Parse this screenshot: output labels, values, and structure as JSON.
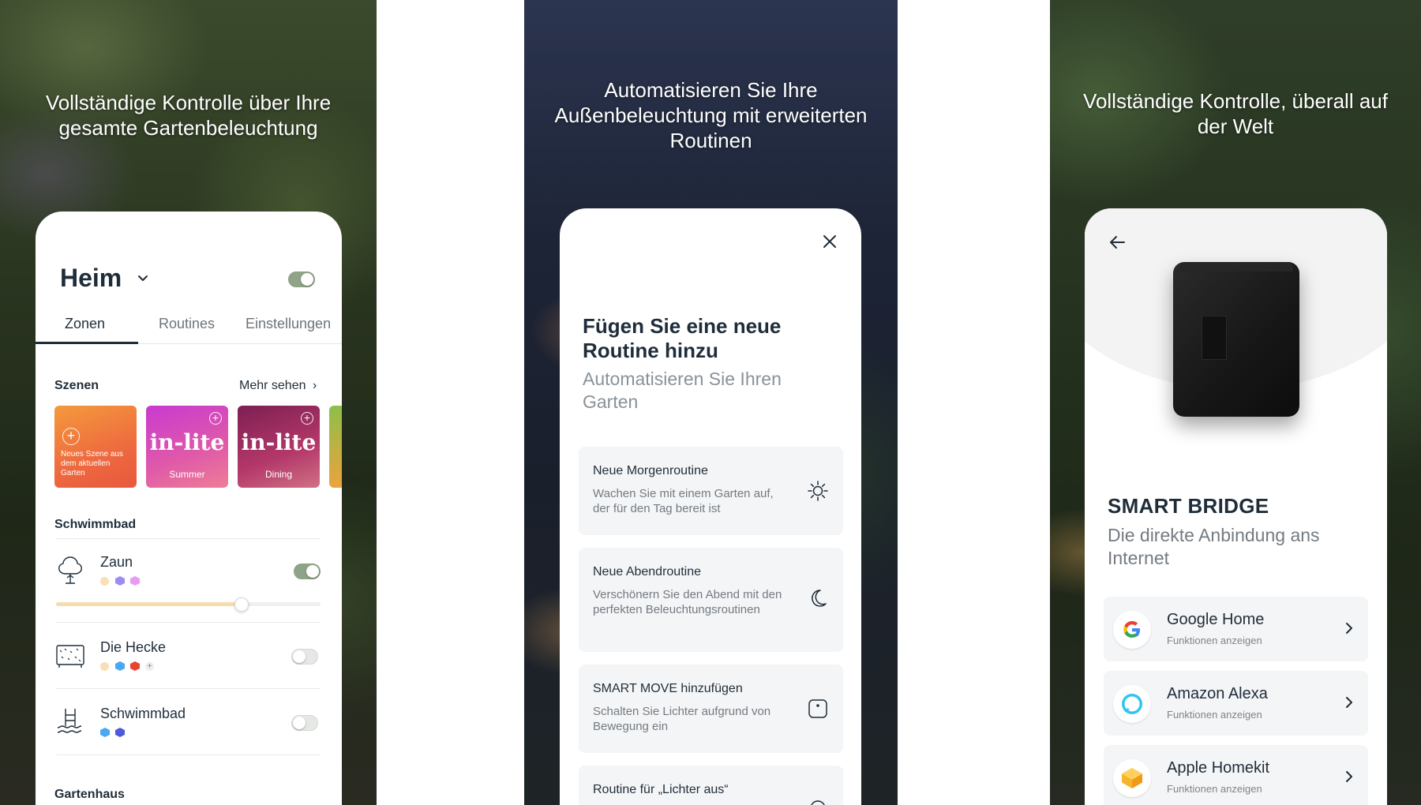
{
  "panel1": {
    "headline": "Vollständige Kontrolle über Ihre gesamte Gartenbeleuchtung",
    "home_title": "Heim",
    "tabs": [
      "Zonen",
      "Routines",
      "Einstellungen"
    ],
    "scenes_label": "Szenen",
    "more_link": "Mehr sehen",
    "scenes": [
      {
        "text": "Neues Szene aus dem aktuellen Garten"
      },
      {
        "brand": "in-lite",
        "label": "Summer"
      },
      {
        "brand": "in-lite",
        "label": "Dining"
      }
    ],
    "group1": "Schwimmbad",
    "zones": [
      {
        "name": "Zaun",
        "on": true,
        "brightness": 0.7
      },
      {
        "name": "Die Hecke",
        "on": false
      },
      {
        "name": "Schwimmbad",
        "on": false
      }
    ],
    "group2": "Gartenhaus",
    "colors": {
      "toggle_on": "#8fa387",
      "accent_text": "#1f2d3a"
    }
  },
  "panel2": {
    "headline": "Automatisieren Sie Ihre Außenbeleuchtung mit erweiterten Routinen",
    "title": "Fügen Sie eine neue Routine hinzu",
    "subtitle": "Automatisieren Sie Ihren Garten",
    "cards": [
      {
        "title": "Neue Morgenroutine",
        "desc": "Wachen Sie mit einem Garten auf, der für den Tag bereit ist",
        "icon": "sun-icon"
      },
      {
        "title": "Neue Abendroutine",
        "desc": "Verschönern Sie den Abend mit den perfekten Beleuchtungsroutinen",
        "icon": "moon-icon"
      },
      {
        "title": "SMART MOVE hinzufügen",
        "desc": "Schalten Sie Lichter aufgrund von Bewegung ein",
        "icon": "motion-sensor-icon"
      },
      {
        "title": "Routine für „Lichter aus“",
        "desc": "",
        "icon": "power-icon"
      }
    ]
  },
  "panel3": {
    "headline": "Vollständige Kontrolle, überall auf der Welt",
    "title": "SMART BRIDGE",
    "subtitle": "Die direkte Anbindung ans Internet",
    "services": [
      {
        "name": "Google Home",
        "sub": "Funktionen anzeigen",
        "icon": "google-icon"
      },
      {
        "name": "Amazon Alexa",
        "sub": "Funktionen anzeigen",
        "icon": "alexa-icon"
      },
      {
        "name": "Apple Homekit",
        "sub": "Funktionen anzeigen",
        "icon": "homekit-icon"
      }
    ]
  }
}
